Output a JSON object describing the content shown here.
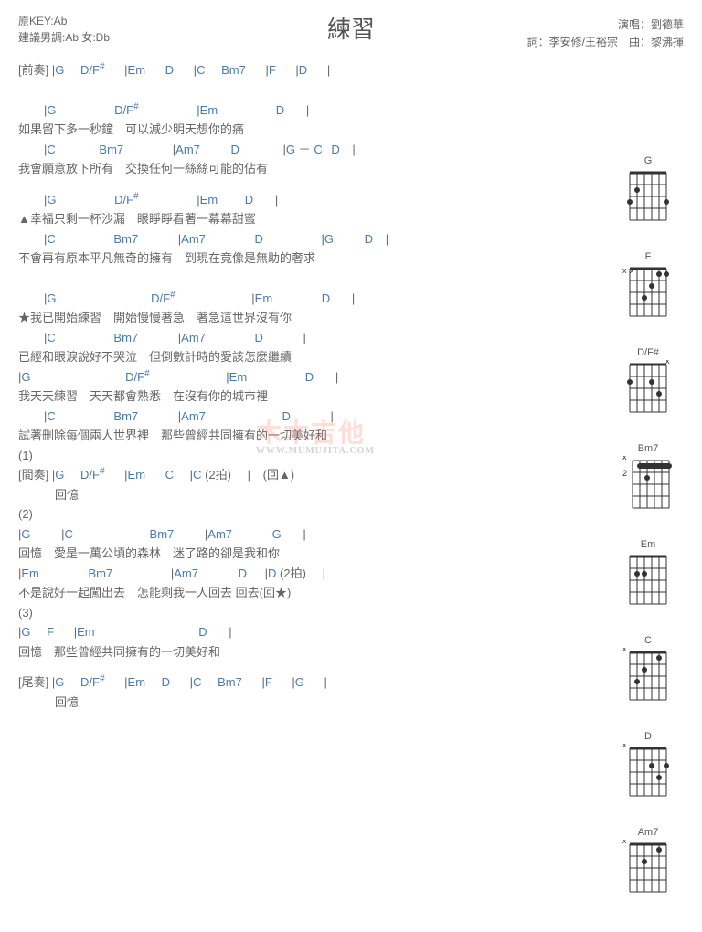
{
  "header": {
    "title": "練習",
    "key_original": "原KEY:Ab",
    "key_suggest": "建議男調:Ab 女:Db",
    "singer_label": "演唱：",
    "singer": "劉德華",
    "lyric_label": "詞：",
    "lyricist": "李安修/王裕宗",
    "composer_label": "曲：",
    "composer": "黎沸揮"
  },
  "sections": {
    "intro_label": "[前奏]",
    "interlude_label": "[間奏]",
    "outro_label": "[尾奏]"
  },
  "chords": {
    "G": "G",
    "D": "D",
    "FSharp": "F#",
    "Em": "Em",
    "C": "C",
    "Bm7": "Bm7",
    "F": "F",
    "Am7": "Am7",
    "DFs": "D/F"
  },
  "lyrics": {
    "l1": "如果留下多一秒鐘　可以減少明天想你的痛",
    "l2": "我會願意放下所有　交換任何一絲絲可能的佔有",
    "l3": "▲幸福只剩一杯沙漏　眼睜睜看著一幕幕甜蜜",
    "l4": "不會再有原本平凡無奇的擁有　到現在竟像是無助的奢求",
    "l5": "★我已開始練習　開始慢慢著急　著急這世界沒有你",
    "l6": "已經和眼淚說好不哭泣　但倒數計時的愛該怎麼繼續",
    "l7": "我天天練習　天天都會熟悉　在沒有你的城市裡",
    "l8": "試著刪除每個兩人世界裡　那些曾經共同擁有的一切美好和",
    "mem": "回憶",
    "two_beat": "(2拍)",
    "back_tri": "(回▲)",
    "back_star": "(回★)",
    "dash": "－",
    "n1": "(1)",
    "n2": "(2)",
    "n3": "(3)",
    "b1": "回憶　愛是一萬公頃的森林　迷了路的卻是我和你",
    "b2": "不是說好一起闖出去　怎能剩我一人回去 回去",
    "b3": "回憶　那些曾經共同擁有的一切美好和"
  },
  "diagram_names": [
    "G",
    "F",
    "D/F#",
    "Bm7",
    "Em",
    "C",
    "D",
    "Am7"
  ],
  "watermark": "木木吉他",
  "watermark_sub": "WWW.MUMUJITA.COM"
}
